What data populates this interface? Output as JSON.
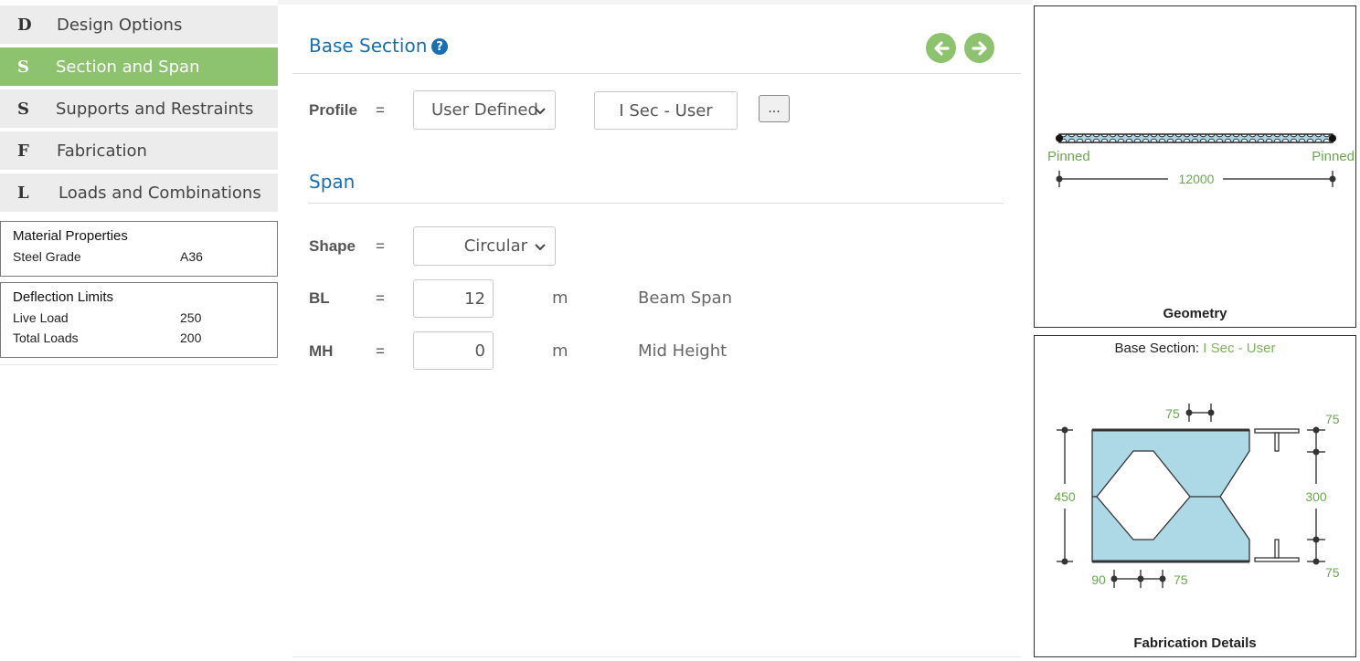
{
  "sidebar": {
    "items": [
      {
        "letter": "D",
        "label": "Design Options",
        "active": false
      },
      {
        "letter": "S",
        "label": "Section and Span",
        "active": true
      },
      {
        "letter": "S",
        "label": "Supports and Restraints",
        "active": false
      },
      {
        "letter": "F",
        "label": "Fabrication",
        "active": false
      },
      {
        "letter": "L",
        "label": "Loads and Combinations",
        "active": false
      }
    ],
    "material": {
      "title": "Material Properties",
      "rows": [
        {
          "key": "Steel Grade",
          "value": "A36"
        }
      ]
    },
    "deflection": {
      "title": "Deflection Limits",
      "rows": [
        {
          "key": "Live Load",
          "value": "250"
        },
        {
          "key": "Total Loads",
          "value": "200"
        }
      ]
    }
  },
  "main": {
    "base_section": {
      "title": "Base Section",
      "help_icon": "question-circle-icon",
      "profile_label": "Profile",
      "equals": "=",
      "profile_value": "User Defined",
      "section_name": "I Sec - User",
      "more_label": "..."
    },
    "span": {
      "title": "Span",
      "shape_label": "Shape",
      "shape_value": "Circular",
      "bl_label": "BL",
      "bl_value": "12",
      "bl_unit": "m",
      "bl_desc": "Beam Span",
      "mh_label": "MH",
      "mh_value": "0",
      "mh_unit": "m",
      "mh_desc": "Mid Height"
    },
    "prev_icon": "arrow-left-circle-icon",
    "next_icon": "arrow-right-circle-icon"
  },
  "geometry": {
    "caption": "Geometry",
    "left_support": "Pinned",
    "right_support": "Pinned",
    "span_dim": "12000"
  },
  "fabrication": {
    "header_prefix": "Base Section:",
    "header_value": "I Sec - User",
    "caption": "Fabrication Details",
    "dims": {
      "top": "75",
      "total_height": "450",
      "right_top": "75",
      "right_middle": "300",
      "right_bottom": "75",
      "bottom_left": "90",
      "bottom_right": "75"
    }
  },
  "colors": {
    "accent_green": "#8dc26f",
    "title_blue": "#1a6fb0",
    "section_fill": "#add8e6"
  }
}
